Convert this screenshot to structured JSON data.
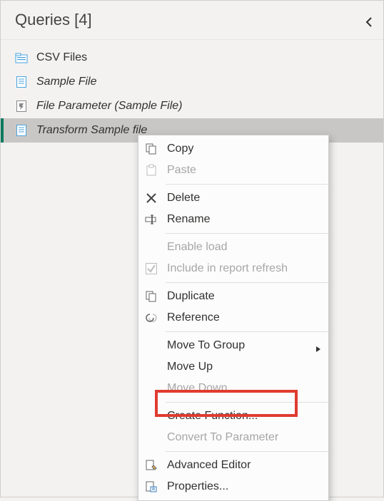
{
  "header": {
    "title": "Queries [4]"
  },
  "queries": [
    {
      "name": "CSV Files",
      "icon": "folder"
    },
    {
      "name": "Sample File",
      "icon": "doc",
      "italic": true
    },
    {
      "name": "File Parameter (Sample File)",
      "icon": "param",
      "italic": true
    },
    {
      "name": "Transform Sample file",
      "icon": "doc",
      "italic": true,
      "selected": true
    }
  ],
  "menu": {
    "copy": "Copy",
    "paste": "Paste",
    "delete": "Delete",
    "rename": "Rename",
    "enable_load": "Enable load",
    "include_refresh": "Include in report refresh",
    "duplicate": "Duplicate",
    "reference": "Reference",
    "move_to_group": "Move To Group",
    "move_up": "Move Up",
    "move_down": "Move Down",
    "create_function": "Create Function...",
    "convert_to_parameter": "Convert To Parameter",
    "advanced_editor": "Advanced Editor",
    "properties": "Properties..."
  }
}
